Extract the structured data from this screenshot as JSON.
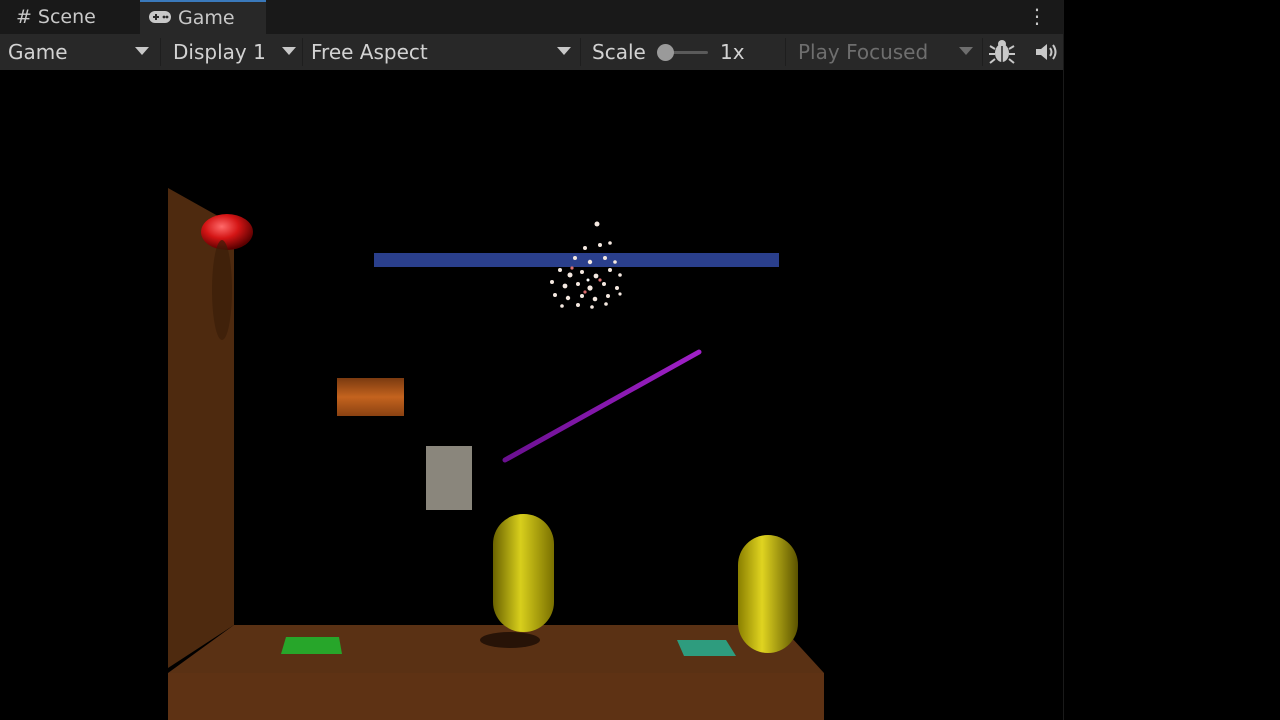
{
  "tabs": [
    {
      "label": "Scene",
      "icon": "hash-icon",
      "active": false
    },
    {
      "label": "Game",
      "icon": "gamepad-icon",
      "active": true
    }
  ],
  "toolbar": {
    "view_select": "Game",
    "display_select": "Display 1",
    "aspect_select": "Free Aspect",
    "scale_label": "Scale",
    "scale_value": "1x",
    "play_mode_select": "Play Focused"
  },
  "icons": {
    "menu": "kebab-menu-icon",
    "stats": "bug-icon",
    "audio": "speaker-icon"
  },
  "colors": {
    "tab_accent": "#3a79bb",
    "toolbar_bg": "#282828",
    "tabstrip_bg": "#191919"
  }
}
